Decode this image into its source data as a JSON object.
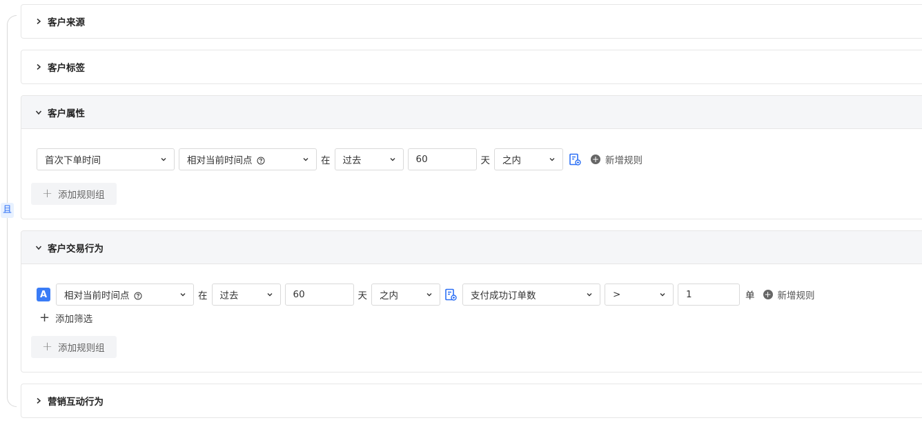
{
  "and_label": "且",
  "panels": {
    "source": {
      "title": "客户来源"
    },
    "tags": {
      "title": "客户标签"
    },
    "attrs": {
      "title": "客户属性",
      "rule": {
        "field": "首次下单时间",
        "time_mode": "相对当前时间点",
        "in_word": "在",
        "period": "过去",
        "amount": "60",
        "unit": "天",
        "range": "之内"
      },
      "add_rule": "新增规则",
      "add_group": "添加规则组"
    },
    "trade": {
      "title": "客户交易行为",
      "badge": "A",
      "rule": {
        "time_mode": "相对当前时间点",
        "in_word": "在",
        "period": "过去",
        "amount": "60",
        "unit": "天",
        "range": "之内",
        "metric": "支付成功订单数",
        "operator": ">",
        "value": "1",
        "value_unit": "单"
      },
      "add_rule": "新增规则",
      "add_filter": "添加筛选",
      "add_group": "添加规则组"
    },
    "marketing": {
      "title": "营销互动行为"
    }
  },
  "colors": {
    "accent": "#2b6ff5",
    "badge": "#3a7cf6"
  }
}
